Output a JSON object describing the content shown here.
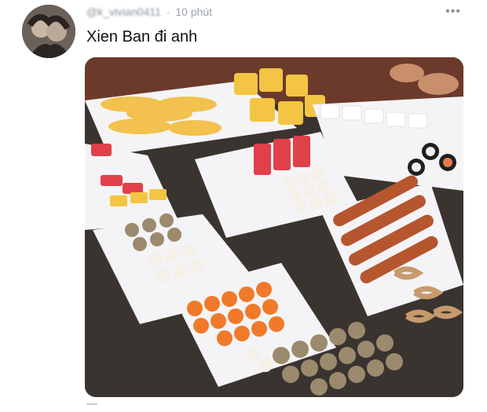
{
  "tweet": {
    "author_handle": "@k_vivian0411",
    "time": "10 phút",
    "more_icon": "more-icon",
    "text": "Xien Ban đi anh"
  },
  "photo": {
    "subject": "street-food skewers on trays",
    "colors": {
      "tray": "#f4f4f6",
      "corn": "#f2c14e",
      "tofu": "#f3c542",
      "crab": "#e0404a",
      "fishball": "#f5f0e8",
      "carrot": "#f07a2a",
      "meatball": "#9c8a6e",
      "sausage": "#b5562e",
      "background": "#3a3430"
    }
  }
}
